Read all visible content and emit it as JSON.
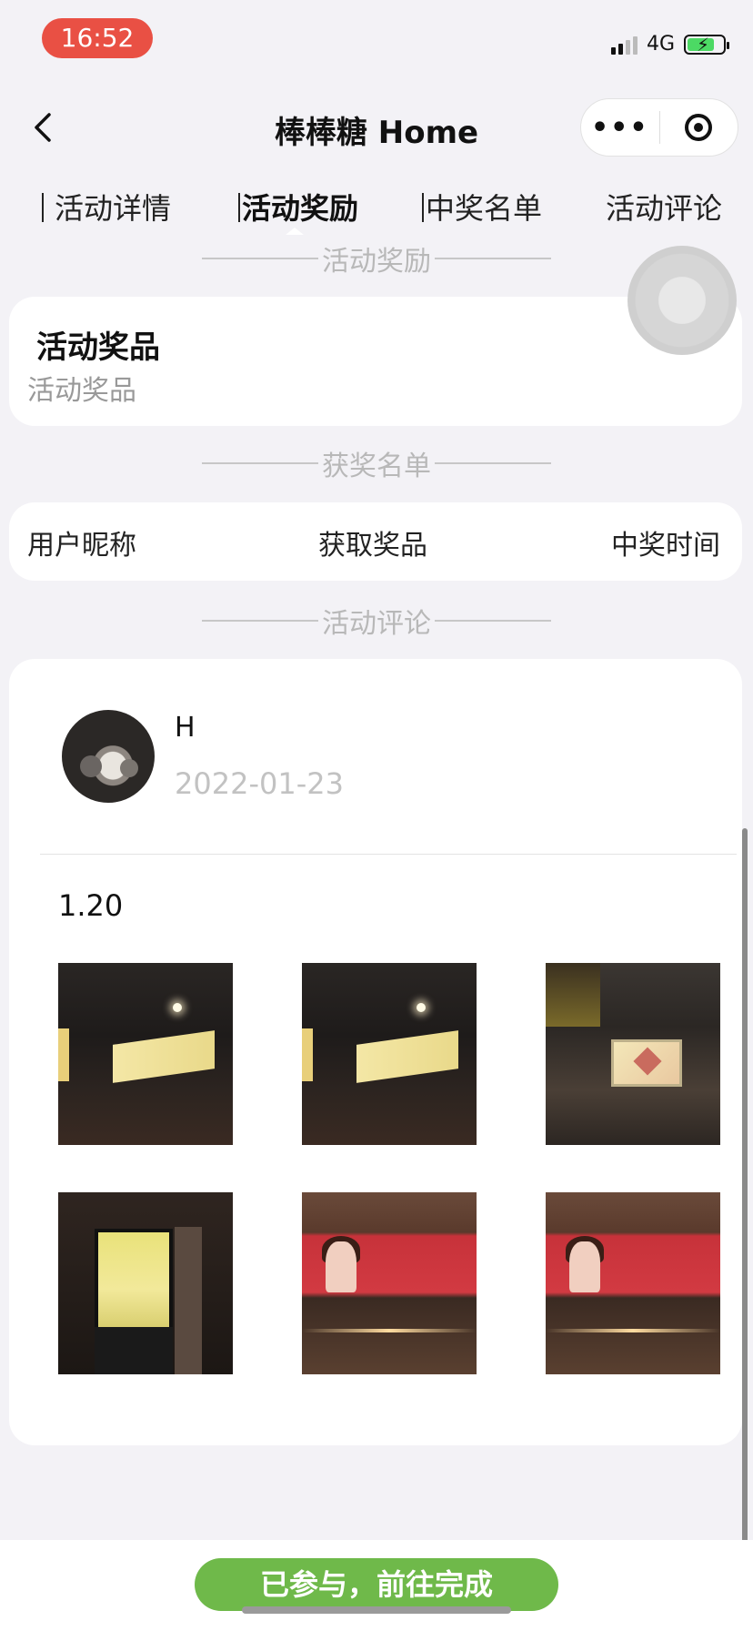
{
  "status": {
    "time": "16:52",
    "network": "4G"
  },
  "nav": {
    "title": "棒棒糖 Home",
    "more_icon": "more-dots-icon",
    "record_icon": "record-target-icon",
    "back_icon": "back-chevron-icon"
  },
  "tabs": [
    {
      "label": "活动详情"
    },
    {
      "label": "活动奖励"
    },
    {
      "label": "中奖名单"
    },
    {
      "label": "活动评论"
    }
  ],
  "sections": {
    "reward": "活动奖励",
    "winners": "获奖名单",
    "comments": "活动评论"
  },
  "prize": {
    "title": "活动奖品",
    "subtitle": "活动奖品"
  },
  "winner_table": {
    "col1": "用户昵称",
    "col2": "获取奖品",
    "col3": "中奖时间"
  },
  "comment": {
    "user": "H",
    "date": "2022-01-23",
    "text": "1.20"
  },
  "cta": {
    "label": "已参与，前往完成"
  },
  "colors": {
    "accent": "#6fb94a",
    "time_pill": "#e95044"
  }
}
